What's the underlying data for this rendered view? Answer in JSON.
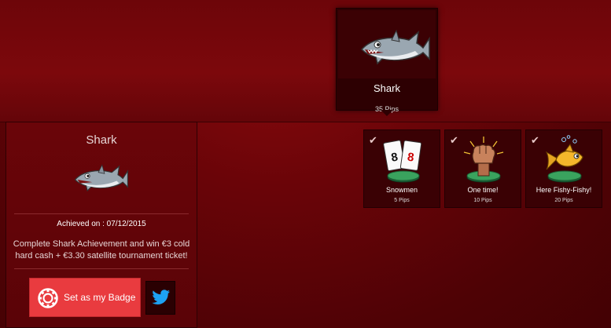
{
  "featured": {
    "title": "Shark",
    "pips": "35 Pips"
  },
  "detail": {
    "title": "Shark",
    "achieved": "Achieved on : 07/12/2015",
    "description": "Complete Shark Achievement and win €3 cold hard cash + €3.30 satellite tournament ticket!",
    "set_badge_label": "Set as my Badge"
  },
  "tiles": [
    {
      "name": "Snowmen",
      "pips": "5 Pips"
    },
    {
      "name": "One time!",
      "pips": "10 Pips"
    },
    {
      "name": "Here Fishy-Fishy!",
      "pips": "20 Pips"
    }
  ],
  "colors": {
    "button": "#e93b3f",
    "twitter": "#1da1f2",
    "background": "#6a0408"
  },
  "check_glyph": "✔"
}
